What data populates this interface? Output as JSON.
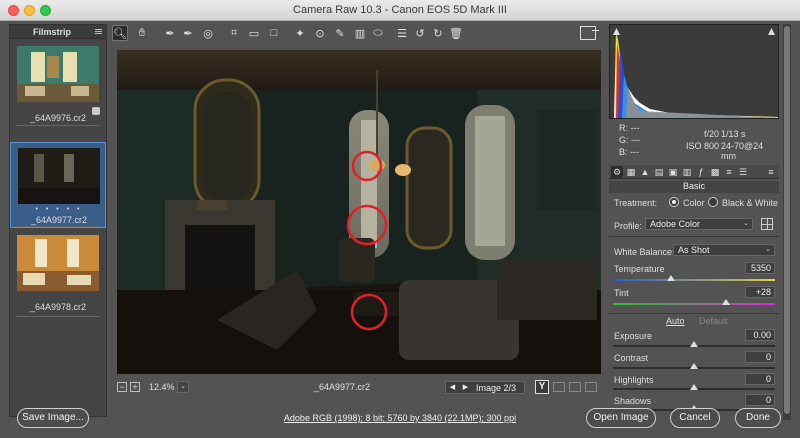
{
  "window": {
    "title": "Camera Raw 10.3  -  Canon EOS 5D Mark III"
  },
  "filmstrip": {
    "title": "Filmstrip",
    "items": [
      {
        "name": "_64A9976.cr2",
        "selected": false
      },
      {
        "name": "_64A9977.cr2",
        "selected": true,
        "dots": "• • • • •"
      },
      {
        "name": "_64A9978.cr2",
        "selected": false
      }
    ]
  },
  "toolbar": {
    "tools": [
      "zoom-icon",
      "hand-icon",
      "white-balance-icon",
      "color-sampler-icon",
      "targeted-adjustment-icon",
      "crop-icon",
      "straighten-icon",
      "transform-icon",
      "spot-removal-icon",
      "red-eye-icon",
      "adjustment-brush-icon",
      "graduated-filter-icon",
      "radial-filter-icon",
      "presets-list-icon",
      "rotate-left-icon",
      "rotate-right-icon",
      "trash-icon"
    ],
    "active_tool": "zoom-icon"
  },
  "image_bar": {
    "zoom_out": "−",
    "zoom_in": "+",
    "zoom": "12.4%",
    "filename": "_64A9977.cr2",
    "nav_label": "Image 2/3",
    "before_after": "Y"
  },
  "readout": {
    "r": "R:",
    "r_val": "---",
    "g": "G:",
    "g_val": "---",
    "b": "B:",
    "b_val": "---",
    "aperture": "f/20",
    "shutter": "1/13 s",
    "iso": "ISO 800",
    "lens": "24-70@24 mm"
  },
  "panel": {
    "title": "Basic",
    "treatment_label": "Treatment:",
    "treatment_color": "Color",
    "treatment_bw": "Black & White",
    "profile_label": "Profile:",
    "profile_value": "Adobe Color",
    "wb_label": "White Balance:",
    "wb_value": "As Shot",
    "auto": "Auto",
    "default": "Default",
    "sliders": {
      "temperature": {
        "label": "Temperature",
        "value": "5350",
        "pos": 0.36
      },
      "tint": {
        "label": "Tint",
        "value": "+28",
        "pos": 0.7
      },
      "exposure": {
        "label": "Exposure",
        "value": "0.00",
        "pos": 0.5
      },
      "contrast": {
        "label": "Contrast",
        "value": "0",
        "pos": 0.5
      },
      "highlights": {
        "label": "Highlights",
        "value": "0",
        "pos": 0.5
      },
      "shadows": {
        "label": "Shadows",
        "value": "0",
        "pos": 0.5
      }
    }
  },
  "footer": {
    "save": "Save Image...",
    "info": "Adobe RGB (1998); 8 bit; 5760 by 3840 (22.1MP); 300 ppi",
    "open": "Open Image",
    "cancel": "Cancel",
    "done": "Done"
  },
  "colors": {
    "selection": "#3a5d8a",
    "panel_bg": "#535353",
    "annotation_red": "#e0202a"
  }
}
